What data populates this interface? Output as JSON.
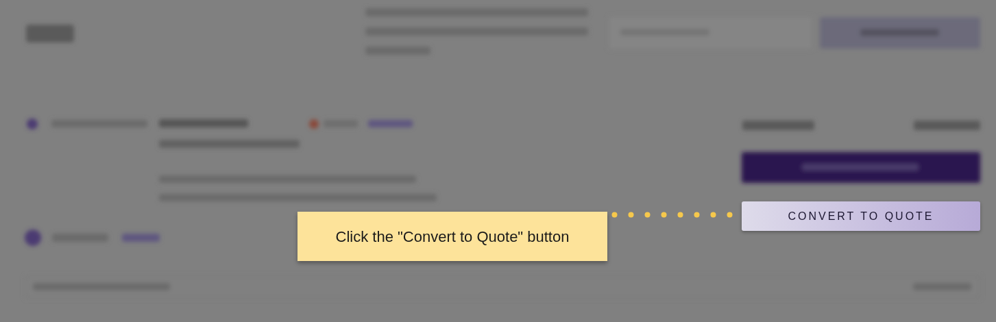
{
  "highlighted_button": {
    "label": "CONVERT TO QUOTE"
  },
  "callout": {
    "text": "Click the \"Convert to Quote\" button"
  }
}
